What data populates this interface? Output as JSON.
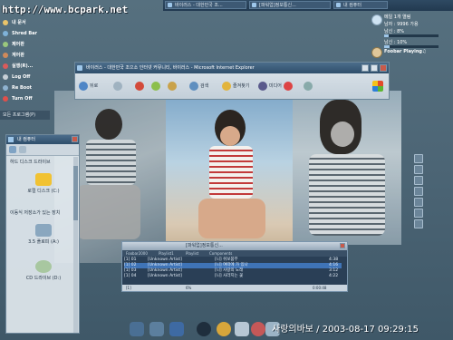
{
  "desktop": {
    "url_banner": "http://www.bcpark.net",
    "clock_text": "사랑의바보 / 2003-08-17 09:29:15"
  },
  "taskbar": {
    "items": [
      {
        "label": "바이러스 - 대한민국 조..."
      },
      {
        "label": "[파워업]정보통신..."
      },
      {
        "label": "내 컴퓨터"
      }
    ]
  },
  "left_menu": {
    "items": [
      {
        "label": "내 문서",
        "color": "#e9c46a"
      },
      {
        "label": "Shred Bar",
        "color": "#7fb2d8"
      },
      {
        "label": "제어판",
        "color": "#9ac77d"
      },
      {
        "label": "계어판",
        "color": "#d08a5b"
      },
      {
        "label": "실행(R)...",
        "color": "#d95b5b"
      },
      {
        "label": "Log Off",
        "color": "#c7cfd6"
      },
      {
        "label": "Re Boot",
        "color": "#8fb2cf"
      },
      {
        "label": "Turn Off",
        "color": "#e0504b"
      }
    ],
    "footer": "모든 프로그램(P)"
  },
  "sysinfo": {
    "line1": "메일 1개 열림",
    "line2": "남자 : 9996 가용",
    "line3": "남신 : 8%",
    "line4": "남신 : 10%",
    "player_status": "Foobar Playing♫",
    "cpu_pct": 8,
    "mem_pct": 10
  },
  "ie_window": {
    "title": "바이러스 - 대한민국 조으소 인터넷 커뮤니티, 바이러스 - Microsoft Internet Explorer",
    "toolbar": [
      {
        "label": "뒤로",
        "color": "#4f86c6"
      },
      {
        "label": "",
        "color": "#9fb2c0"
      },
      {
        "label": "",
        "color": "#d34a3a"
      },
      {
        "label": "",
        "color": "#8cbf4c"
      },
      {
        "label": "",
        "color": "#c9a24a"
      },
      {
        "label": "검색",
        "color": "#5f8fbf"
      },
      {
        "label": "즐겨찾기",
        "color": "#e2b43c"
      },
      {
        "label": "미디어",
        "color": "#5a5a8c"
      },
      {
        "label": "",
        "color": "#d44"
      },
      {
        "label": "",
        "color": "#8aa"
      }
    ]
  },
  "my_computer": {
    "title": "내 컴퓨터",
    "section1": "하드 디스크 드라이브",
    "section2": "이동식 저장소가 있는 장치",
    "drives": [
      {
        "label": "로컬 디스크 (C:)",
        "color": "#f1c232"
      },
      {
        "label": "3.5 플로피 (A:)",
        "color": "#8aa7bf"
      },
      {
        "label": "CD 드라이브 (D:)",
        "color": "#a8c7a0"
      }
    ]
  },
  "player": {
    "title": "[파워업]정보통신...",
    "tabs": [
      "Foobar2000",
      "Playlist1",
      "Playlist",
      "Components"
    ],
    "tracks": [
      {
        "num": "[1] 01",
        "artist": "[Unknown Artist]",
        "title": "[니] 쉬보뭄무",
        "time": "4:38"
      },
      {
        "num": "[1] 02",
        "artist": "[Unknown Artist]",
        "title": "[니] 여떠에 가 있나",
        "time": "4:16"
      },
      {
        "num": "[1] 03",
        "artist": "[Unknown Artist]",
        "title": "[니] 사랑의 노래",
        "time": "3:12"
      },
      {
        "num": "[1] 04",
        "artist": "[Unknown Artist]",
        "title": "[니] 사라지는 꽃",
        "time": "4:22"
      }
    ],
    "status_left": "[1]",
    "status_mid": "6%",
    "status_right": "0:00:48",
    "selected_index": 1
  },
  "dock": {
    "items": [
      {
        "name": "dock-icon-1",
        "color": "#4a6f94"
      },
      {
        "name": "dock-icon-2",
        "color": "#5c7f9e"
      },
      {
        "name": "dock-icon-3",
        "color": "#3e6aa3"
      },
      {
        "name": "dock-icon-4",
        "color": "#1f2e3d"
      },
      {
        "name": "dock-icon-5",
        "color": "#d8a63b"
      },
      {
        "name": "dock-icon-6",
        "color": "#b7c7d4"
      },
      {
        "name": "dock-icon-7",
        "color": "#c55858"
      },
      {
        "name": "dock-icon-8",
        "color": "#9cb4c6"
      }
    ]
  }
}
